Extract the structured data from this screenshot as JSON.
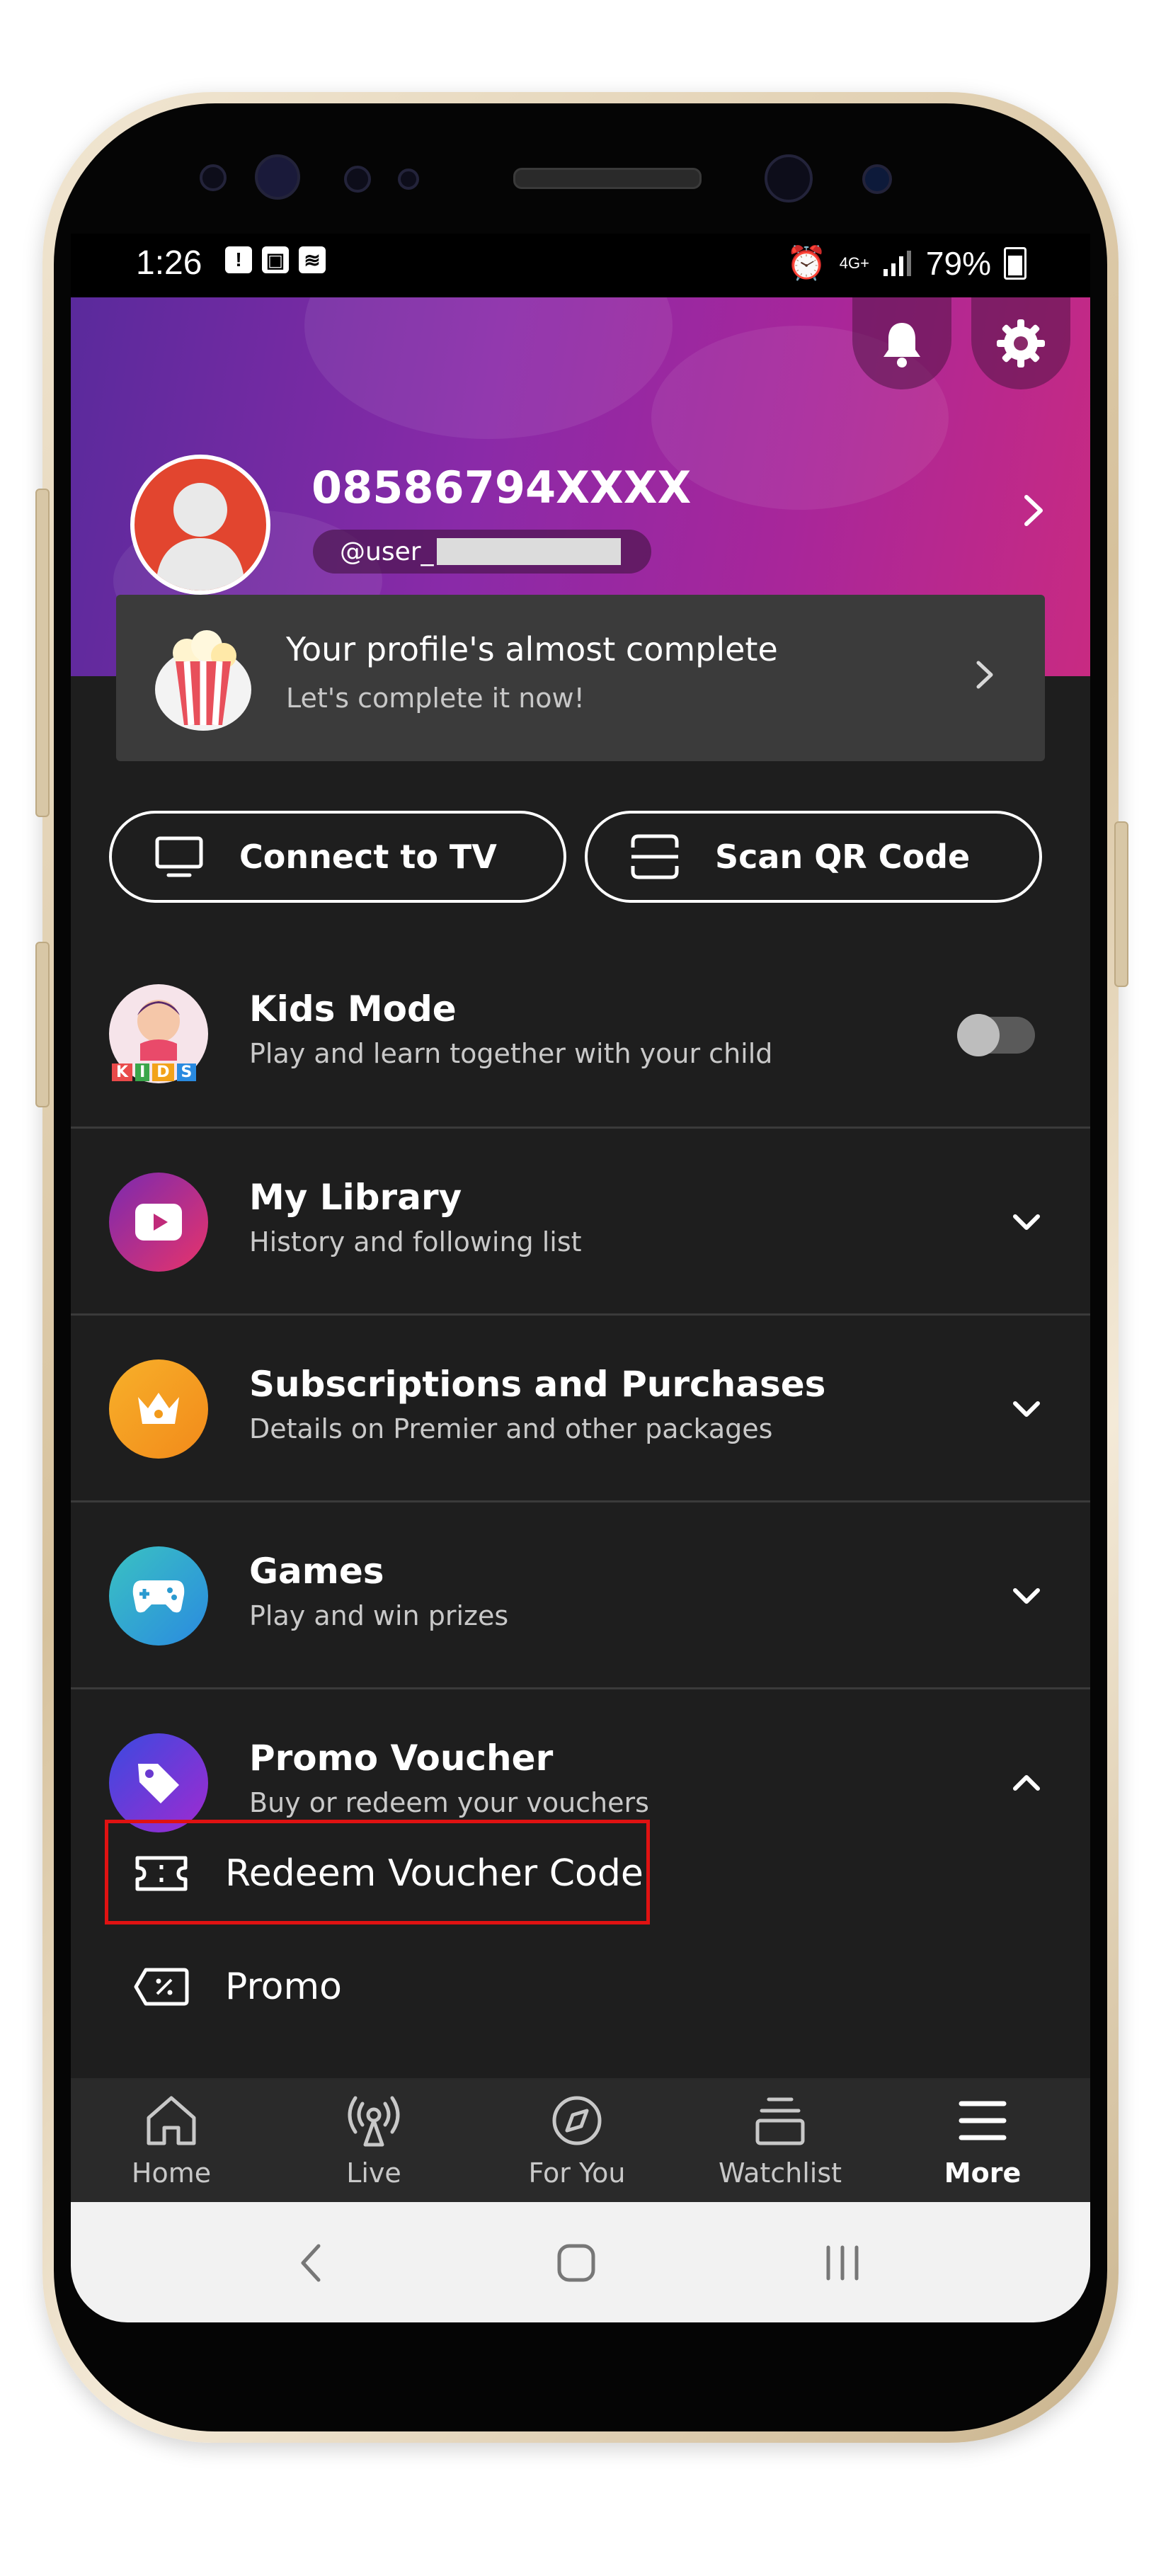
{
  "status_bar": {
    "time": "1:26",
    "battery": "79%",
    "network": "4G+",
    "left_icons": [
      "!",
      "▣",
      "≋"
    ]
  },
  "header": {
    "username": "08586794XXXX",
    "handle": "@user_"
  },
  "profile_card": {
    "title": "Your profile's almost complete",
    "subtitle": "Let's complete it now!"
  },
  "actions": {
    "connect_tv": "Connect to TV",
    "scan_qr": "Scan QR Code"
  },
  "menu": [
    {
      "title": "Kids Mode",
      "subtitle": "Play and learn together with your child",
      "toggle_on": false
    },
    {
      "title": "My Library",
      "subtitle": "History and following list"
    },
    {
      "title": "Subscriptions and Purchases",
      "subtitle": "Details on Premier and other packages"
    },
    {
      "title": "Games",
      "subtitle": "Play and win prizes"
    },
    {
      "title": "Promo Voucher",
      "subtitle": "Buy or redeem your vouchers"
    }
  ],
  "kids_badge": [
    "K",
    "I",
    "D",
    "S"
  ],
  "promo_submenu": {
    "redeem": "Redeem Voucher Code",
    "promo": "Promo"
  },
  "bottom_nav": {
    "home": "Home",
    "live": "Live",
    "for_you": "For You",
    "watchlist": "Watchlist",
    "more": "More",
    "active": "More"
  },
  "colors": {
    "accent_purple": "#7a2ab0",
    "accent_pink": "#c82a82",
    "highlight": "#e01212",
    "background": "#1e1e1e"
  }
}
